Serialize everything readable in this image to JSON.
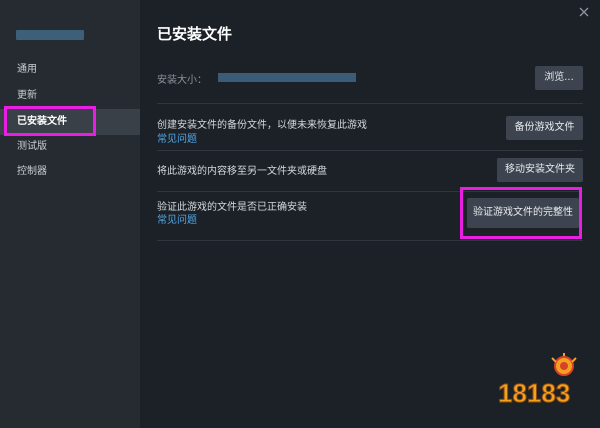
{
  "sidebar": {
    "items": [
      {
        "label": "通用",
        "active": false
      },
      {
        "label": "更新",
        "active": false
      },
      {
        "label": "已安装文件",
        "active": true
      },
      {
        "label": "测试版",
        "active": false
      },
      {
        "label": "控制器",
        "active": false
      }
    ]
  },
  "main": {
    "title": "已安装文件",
    "install_size_label": "安装大小：",
    "browse_button": "浏览...",
    "backup": {
      "description": "创建安装文件的备份文件，以便未来恢复此游戏",
      "faq_link": "常见问题",
      "button": "备份游戏文件"
    },
    "move": {
      "description": "将此游戏的内容移至另一文件夹或硬盘",
      "button": "移动安装文件夹"
    },
    "verify": {
      "description": "验证此游戏的文件是否已正确安装",
      "faq_link": "常见问题",
      "button": "验证游戏文件的完整性"
    }
  },
  "watermark": {
    "text": "18183"
  },
  "colors": {
    "highlight": "#e91ee3",
    "link": "#52a7e8",
    "background": "#1b2127",
    "sidebar": "#262b31"
  },
  "icons": {
    "close": "close-icon"
  }
}
